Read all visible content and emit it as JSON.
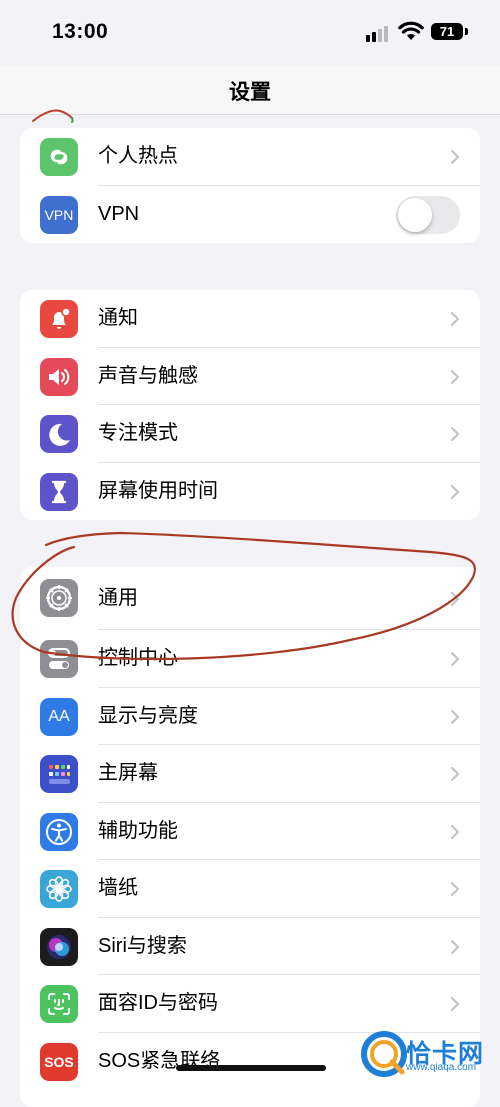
{
  "status": {
    "time": "13:00",
    "battery": "71"
  },
  "nav": {
    "title": "设置"
  },
  "group1": [
    {
      "id": "hotspot",
      "label": "个人热点",
      "icon": "hotspot-icon",
      "color": "#5cc46a",
      "control": "chevron"
    },
    {
      "id": "vpn",
      "label": "VPN",
      "icon_text": "VPN",
      "icon": "vpn-icon",
      "color": "#3f6fcf",
      "control": "toggle",
      "toggle_on": false
    }
  ],
  "group2": [
    {
      "id": "notifications",
      "label": "通知",
      "icon": "bell-icon",
      "color": "#e8483f"
    },
    {
      "id": "sounds",
      "label": "声音与触感",
      "icon": "speaker-icon",
      "color": "#e54a5b"
    },
    {
      "id": "focus",
      "label": "专注模式",
      "icon": "moon-icon",
      "color": "#5d54c9"
    },
    {
      "id": "screen_time",
      "label": "屏幕使用时间",
      "icon": "hourglass-icon",
      "color": "#5d54c9"
    }
  ],
  "group3": [
    {
      "id": "general",
      "label": "通用",
      "icon": "gear-icon",
      "color": "#8e8e93"
    },
    {
      "id": "control_center",
      "label": "控制中心",
      "icon": "switches-icon",
      "color": "#8e8e93"
    },
    {
      "id": "display",
      "label": "显示与亮度",
      "icon_text": "AA",
      "icon": "display-icon",
      "color": "#2f7be5"
    },
    {
      "id": "home_screen",
      "label": "主屏幕",
      "icon": "home-grid-icon",
      "color": "#3a4fc8"
    },
    {
      "id": "accessibility",
      "label": "辅助功能",
      "icon": "accessibility-icon",
      "color": "#2f7be5"
    },
    {
      "id": "wallpaper",
      "label": "墙纸",
      "icon": "flower-icon",
      "color": "#3aa6d8"
    },
    {
      "id": "siri",
      "label": "Siri与搜索",
      "icon": "siri-icon",
      "color": "#1c1c1e"
    },
    {
      "id": "face_id",
      "label": "面容ID与密码",
      "icon": "face-id-icon",
      "color": "#4cc35e"
    },
    {
      "id": "sos",
      "label": "SOS紧急联络",
      "icon_text": "SOS",
      "icon": "sos-icon",
      "color": "#e0392e"
    }
  ],
  "watermark": {
    "brand": "恰卡网",
    "url": "www.qiaqa.com",
    "color": "#1f7fd6"
  }
}
